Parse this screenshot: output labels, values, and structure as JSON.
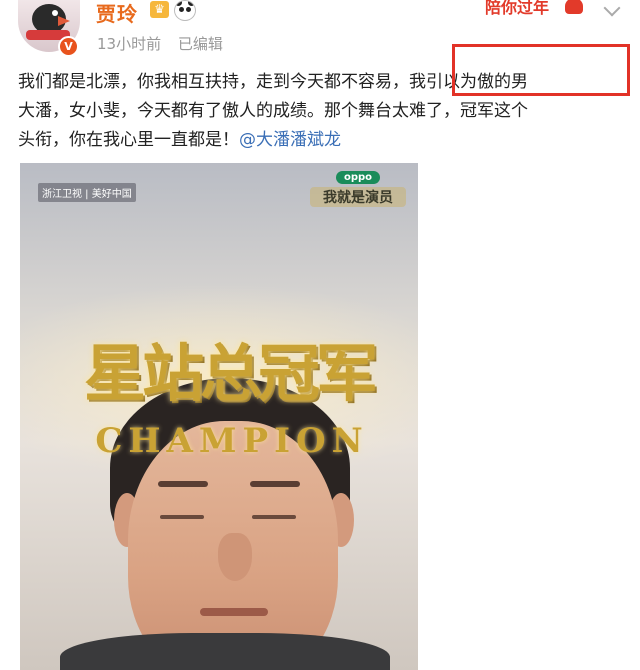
{
  "header": {
    "username": "贾玲",
    "time": "13小时前",
    "edited": "已编辑",
    "banner": "陪你过年",
    "verified_badge": "V"
  },
  "icons": {
    "crown": "crown-icon",
    "panda": "panda-icon",
    "menu": "chevron-down-icon",
    "heart": "heart-icon"
  },
  "post": {
    "line1": "我们都是北漂，你我相互扶持，走到今天都不容易，我引以为傲的男",
    "line2": "大潘，女小斐，今天都有了傲人的成绩。那个舞台太难了，冠军这个",
    "line3_text": "头衔，你在我心里一直都是！",
    "mention": "@大潘潘斌龙"
  },
  "image": {
    "title_cn": "星站总冠军",
    "title_en": "CHAMPION",
    "channel": "浙江卫视 | 美好中国",
    "brand": "oppo",
    "show": "我就是演员"
  },
  "colors": {
    "username": "#e86a1d",
    "mention": "#3b6fb6",
    "highlight_border": "#e23228",
    "gold_title": "#c9a234"
  }
}
